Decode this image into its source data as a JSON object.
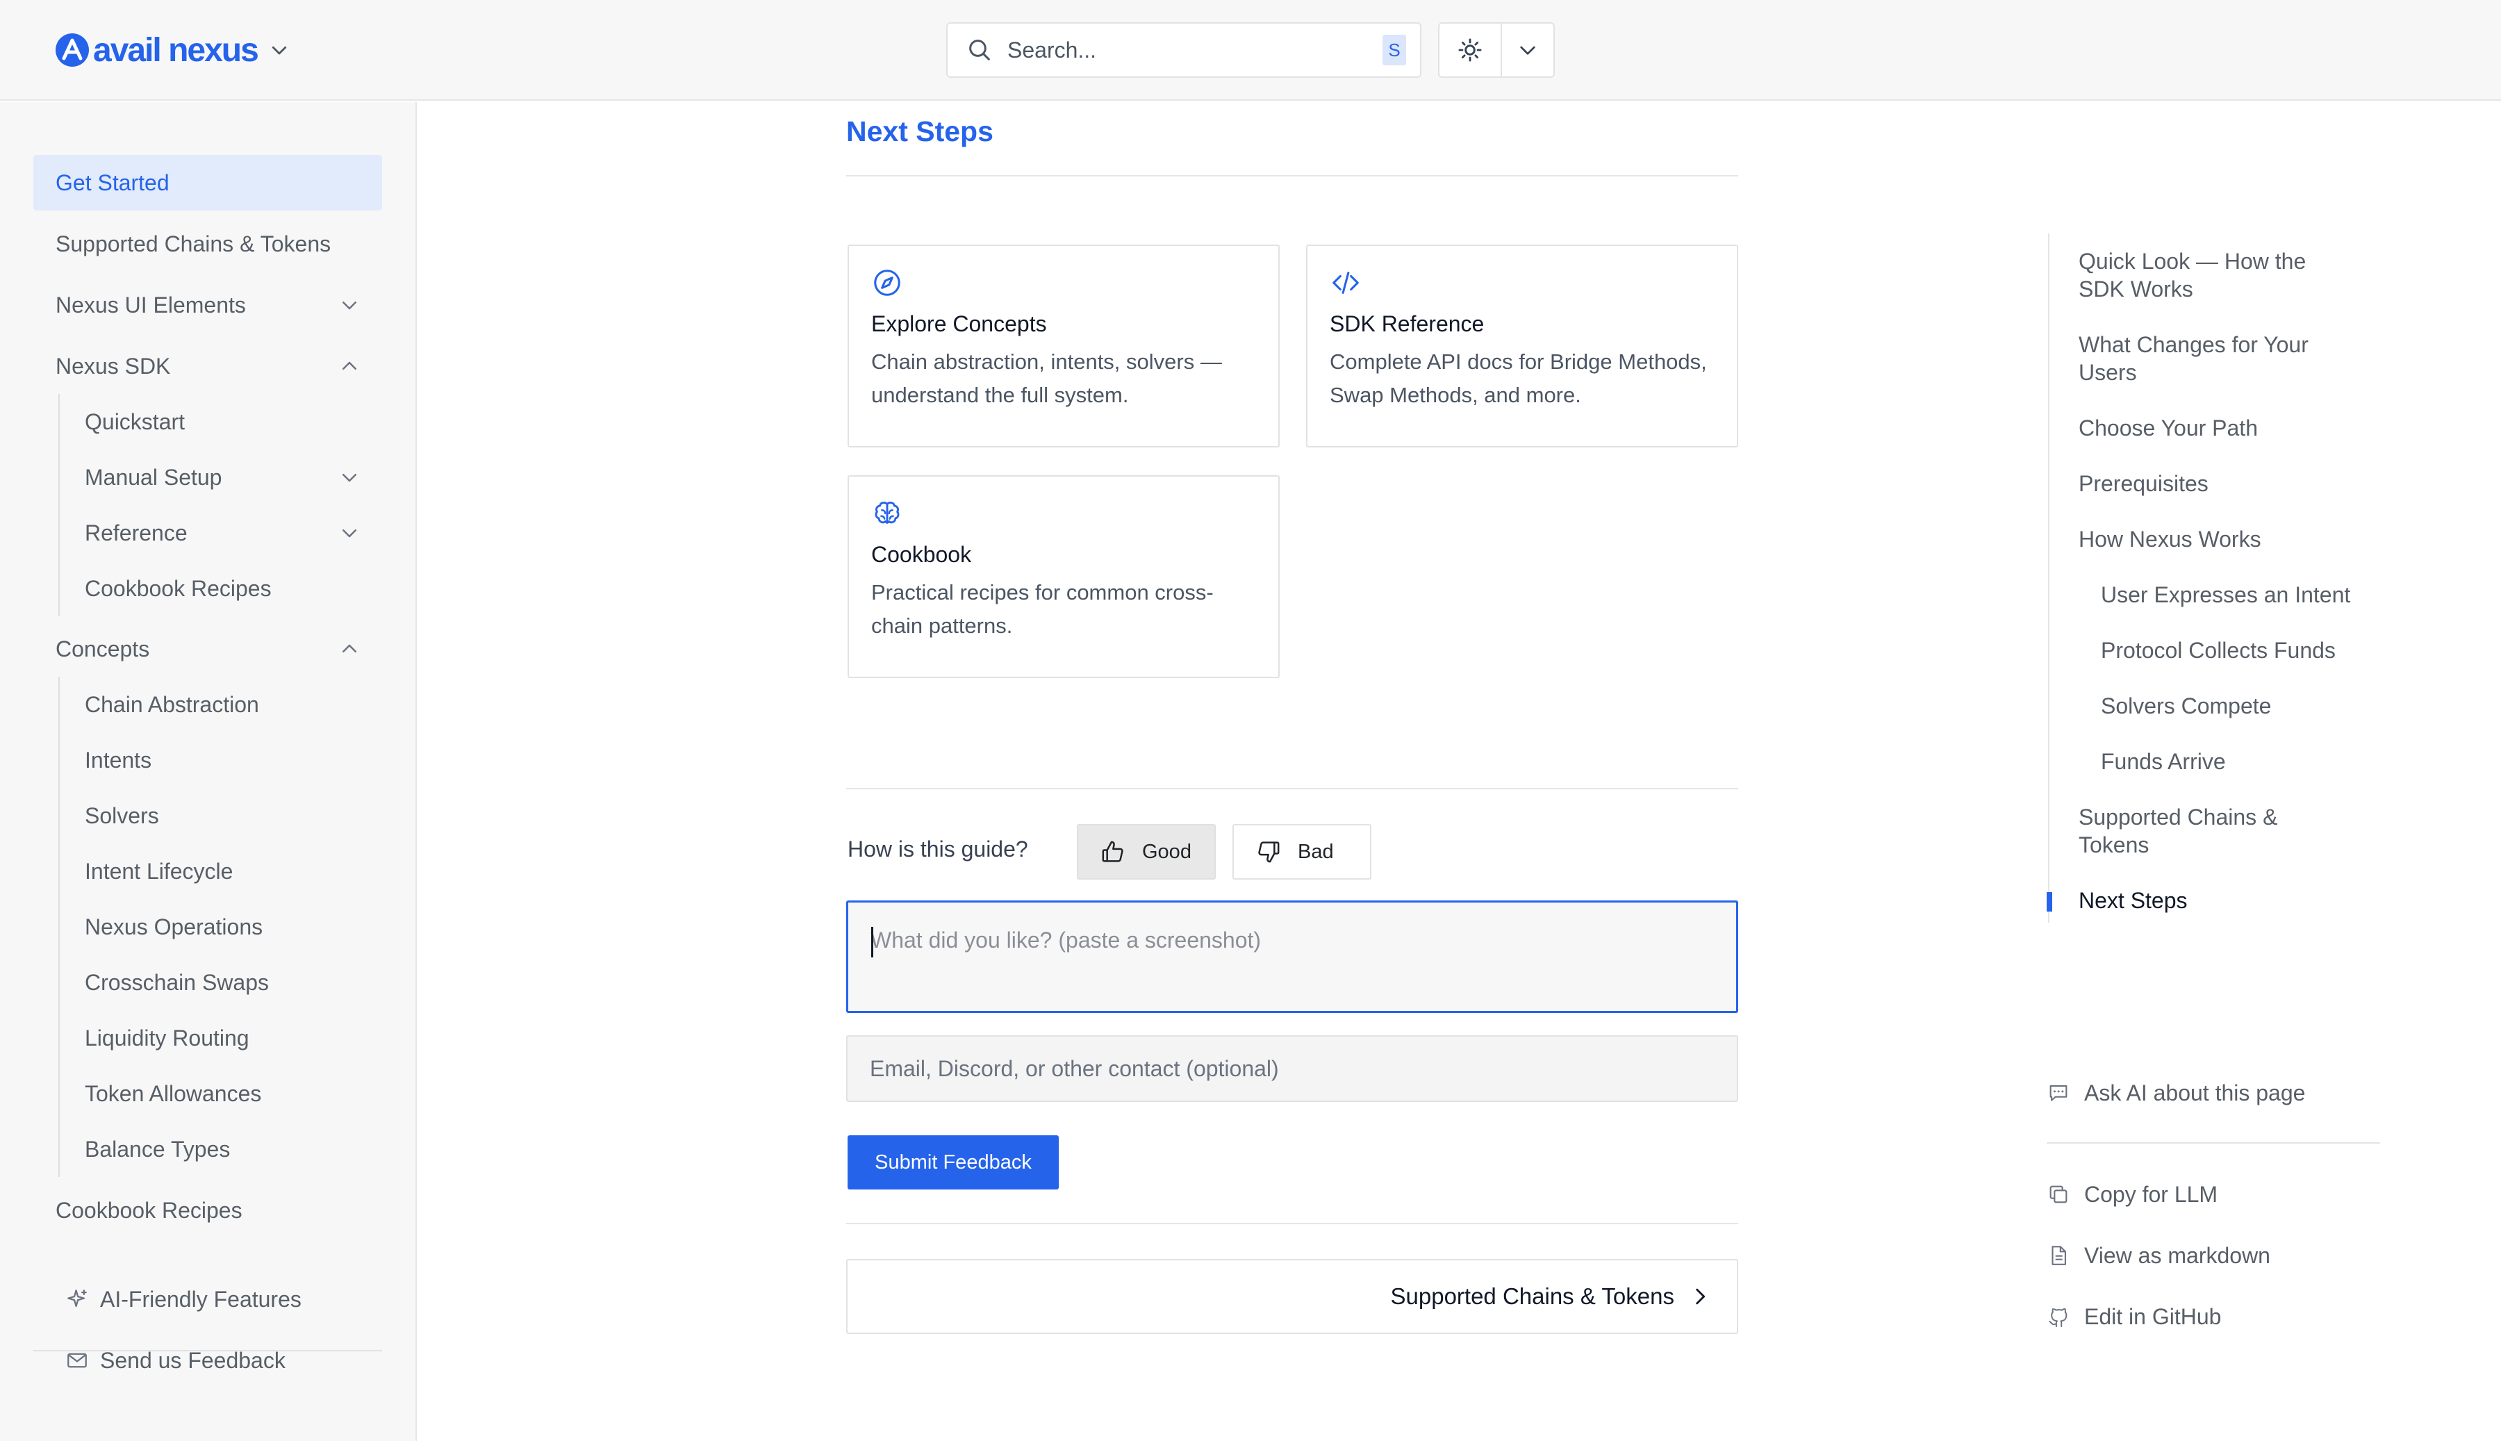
{
  "brand": {
    "name": "avail nexus",
    "color": "#2563eb"
  },
  "search": {
    "placeholder": "Search...",
    "shortcut": "S"
  },
  "sidebar": {
    "items": [
      {
        "label": "Get Started",
        "active": true
      },
      {
        "label": "Supported Chains & Tokens"
      },
      {
        "label": "Nexus UI Elements",
        "expanded": false
      },
      {
        "label": "Nexus SDK",
        "expanded": true
      },
      {
        "label": "Quickstart"
      },
      {
        "label": "Manual Setup",
        "expanded": false
      },
      {
        "label": "Reference",
        "expanded": false
      },
      {
        "label": "Cookbook Recipes"
      },
      {
        "label": "Concepts",
        "expanded": true
      },
      {
        "label": "Chain Abstraction"
      },
      {
        "label": "Intents"
      },
      {
        "label": "Solvers"
      },
      {
        "label": "Intent Lifecycle"
      },
      {
        "label": "Nexus Operations"
      },
      {
        "label": "Crosschain Swaps"
      },
      {
        "label": "Liquidity Routing"
      },
      {
        "label": "Token Allowances"
      },
      {
        "label": "Balance Types"
      },
      {
        "label": "Cookbook Recipes"
      }
    ],
    "footer": [
      {
        "label": "AI-Friendly Features",
        "icon": "sparkle-icon"
      },
      {
        "label": "Send us Feedback",
        "icon": "mail-icon"
      }
    ]
  },
  "main": {
    "title": "Next Steps",
    "cards": [
      {
        "title": "Explore Concepts",
        "desc": "Chain abstraction, intents, solvers — understand the full system.",
        "icon": "compass-icon"
      },
      {
        "title": "SDK Reference",
        "desc": "Complete API docs for Bridge Methods, Swap Methods, and more.",
        "icon": "code-icon"
      },
      {
        "title": "Cookbook",
        "desc": "Practical recipes for common cross-chain patterns.",
        "icon": "brain-icon"
      }
    ],
    "feedback": {
      "question": "How is this guide?",
      "good": "Good",
      "bad": "Bad",
      "selected": "Good",
      "textarea_placeholder": "What did you like? (paste a screenshot)",
      "contact_placeholder": "Email, Discord, or other contact (optional)",
      "submit": "Submit Feedback"
    },
    "next_link": "Supported Chains & Tokens"
  },
  "toc": {
    "items": [
      {
        "label": "Quick Look — How the SDK Works"
      },
      {
        "label": "What Changes for Your Users"
      },
      {
        "label": "Choose Your Path"
      },
      {
        "label": "Prerequisites"
      },
      {
        "label": "How Nexus Works"
      },
      {
        "label": "User Expresses an Intent",
        "sub": true
      },
      {
        "label": "Protocol Collects Funds",
        "sub": true
      },
      {
        "label": "Solvers Compete",
        "sub": true
      },
      {
        "label": "Funds Arrive",
        "sub": true
      },
      {
        "label": "Supported Chains & Tokens"
      },
      {
        "label": "Next Steps",
        "active": true
      }
    ],
    "actions": {
      "ask_ai": "Ask AI about this page",
      "copy_llm": "Copy for LLM",
      "markdown": "View as markdown",
      "github": "Edit in GitHub"
    }
  }
}
